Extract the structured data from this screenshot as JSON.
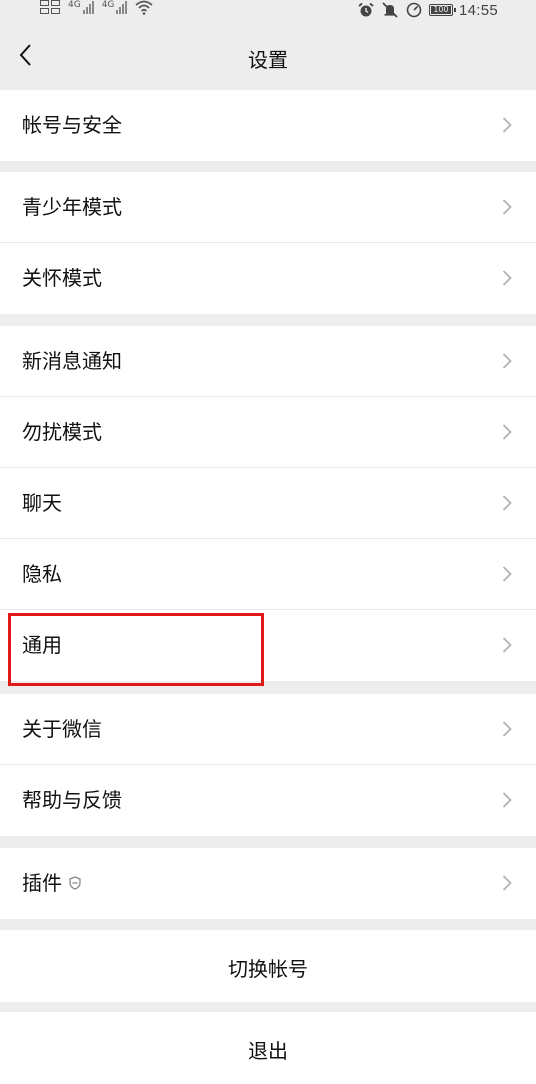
{
  "status_bar": {
    "time": "14:55",
    "net1": "4G",
    "net2": "4G",
    "battery_level": "100"
  },
  "header": {
    "title": "设置"
  },
  "groups": [
    {
      "items": [
        {
          "label": "帐号与安全"
        }
      ]
    },
    {
      "items": [
        {
          "label": "青少年模式"
        },
        {
          "label": "关怀模式"
        }
      ]
    },
    {
      "items": [
        {
          "label": "新消息通知"
        },
        {
          "label": "勿扰模式"
        },
        {
          "label": "聊天"
        },
        {
          "label": "隐私"
        },
        {
          "label": "通用",
          "highlighted": true
        }
      ]
    },
    {
      "items": [
        {
          "label": "关于微信"
        },
        {
          "label": "帮助与反馈"
        }
      ]
    },
    {
      "items": [
        {
          "label": "插件",
          "icon": "shield-icon"
        }
      ]
    }
  ],
  "actions": {
    "switch_account": "切换帐号",
    "logout": "退出"
  },
  "colors": {
    "background": "#ededed",
    "cell": "#ffffff",
    "highlight": "#e01818",
    "chevron": "#b2b2b2"
  }
}
